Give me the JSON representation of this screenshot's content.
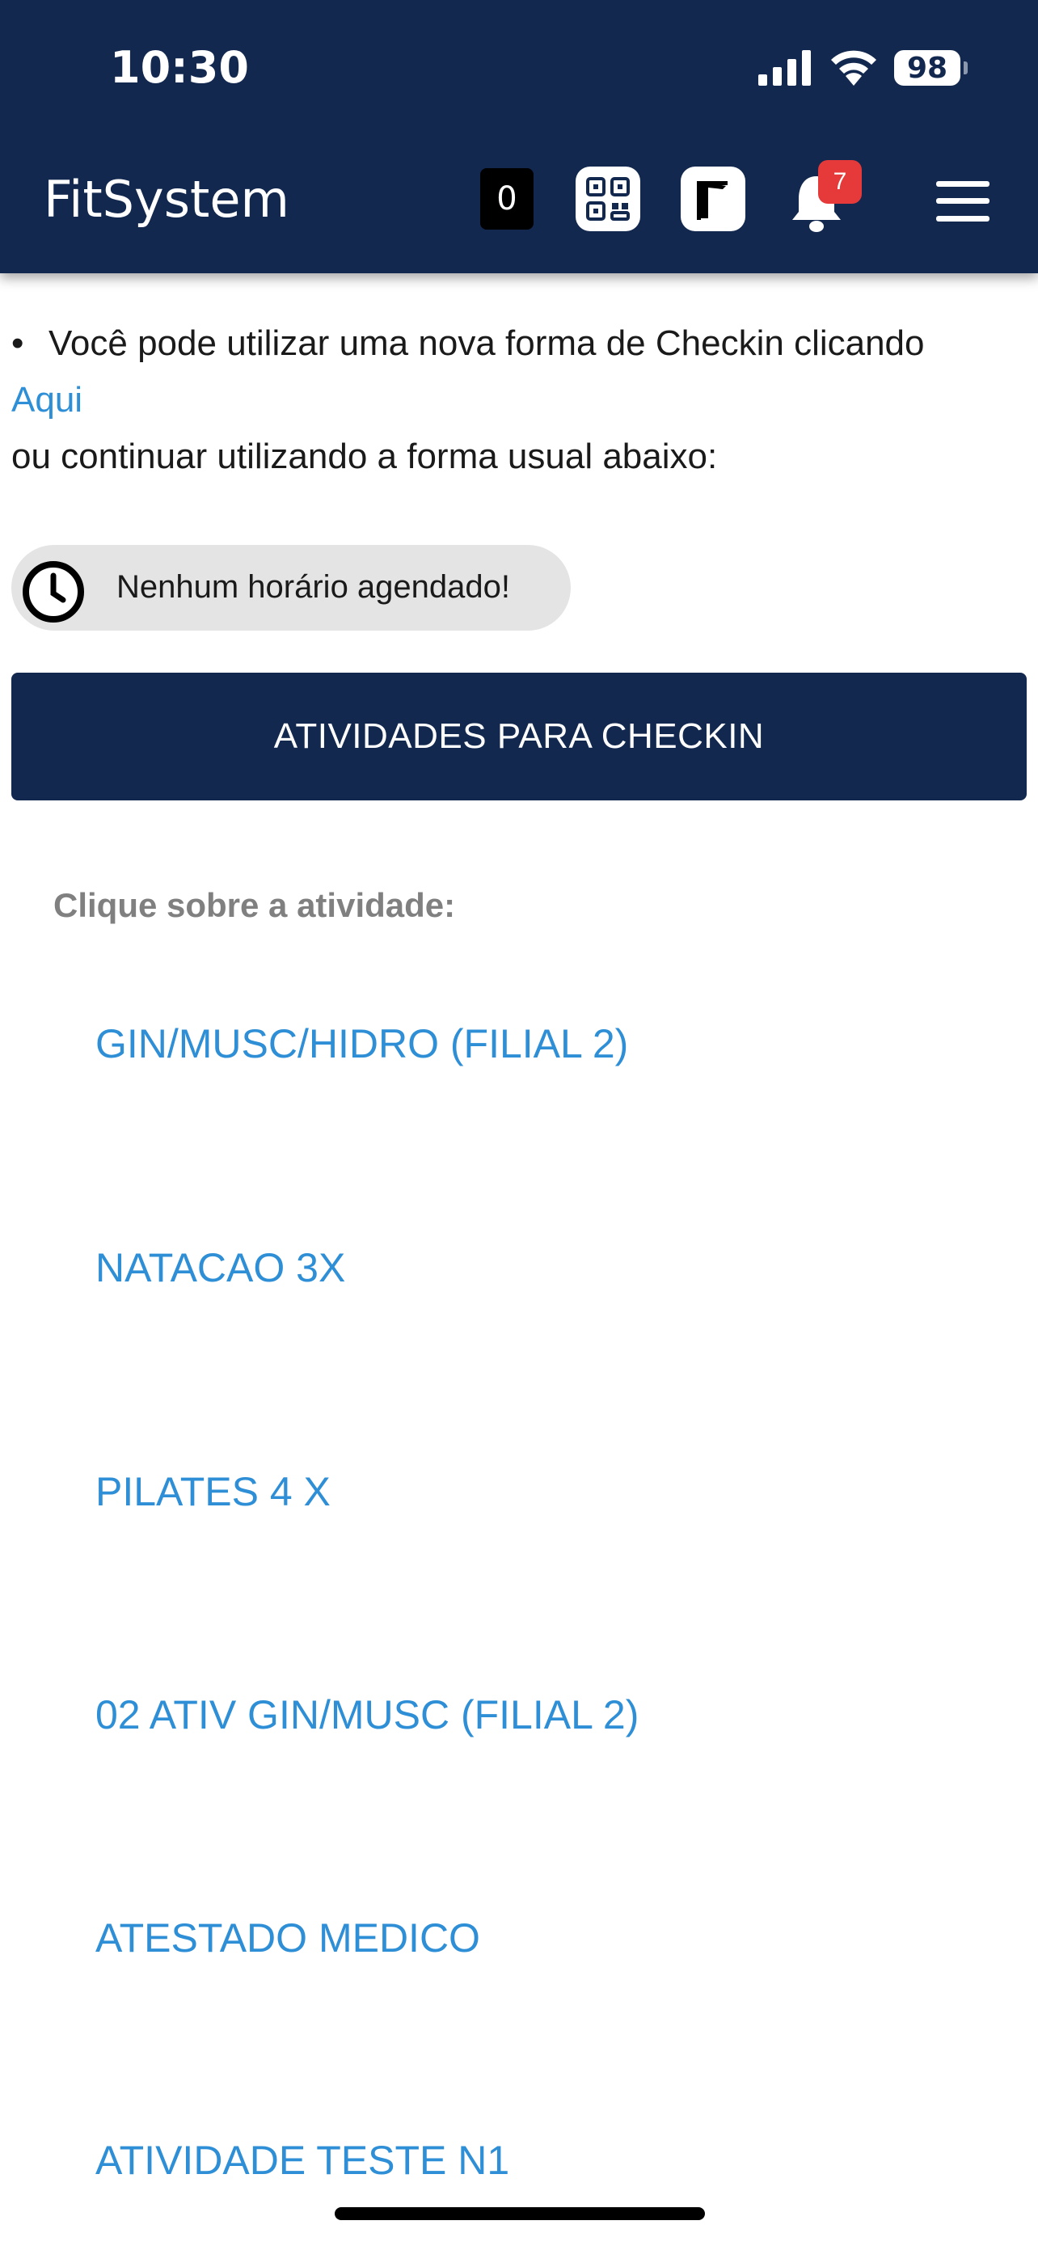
{
  "status_bar": {
    "time": "10:30",
    "battery": "98"
  },
  "header": {
    "title": "FitSystem",
    "counter": "0",
    "notification_count": "7",
    "icons": [
      "qr-code-icon",
      "door-icon",
      "bell-icon",
      "menu-icon"
    ]
  },
  "intro": {
    "bullet": "•",
    "line1": "Você pode utilizar uma nova forma de Checkin clicando",
    "link": "Aqui",
    "line3": "ou continuar utilizando a forma usual abaixo:"
  },
  "schedule": {
    "text": "Nenhum horário agendado!"
  },
  "checkin_button": {
    "label": "ATIVIDADES PARA CHECKIN"
  },
  "activities": {
    "prompt": "Clique sobre a atividade:",
    "items": [
      {
        "label": "GIN/MUSC/HIDRO (FILIAL 2)"
      },
      {
        "label": "NATACAO 3X"
      },
      {
        "label": "PILATES 4 X"
      },
      {
        "label": "02 ATIV GIN/MUSC (FILIAL 2)"
      },
      {
        "label": "ATESTADO MEDICO"
      },
      {
        "label": "ATIVIDADE TESTE N1"
      }
    ]
  },
  "colors": {
    "header_bg": "#12284f",
    "link": "#2e8fd6",
    "badge": "#e63a3a",
    "chip_bg": "#e4e4e4"
  }
}
